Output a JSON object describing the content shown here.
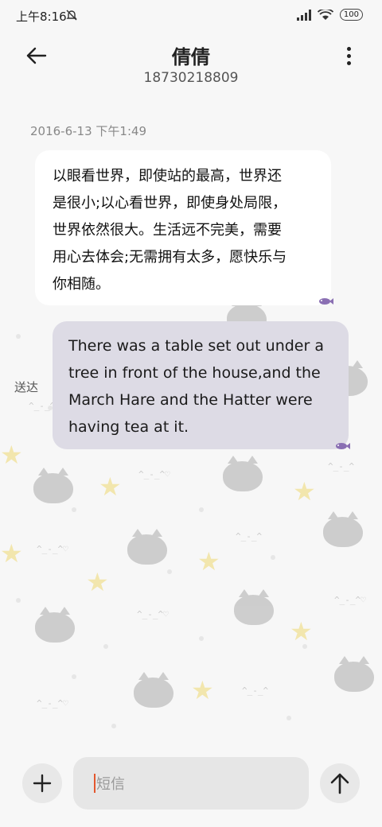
{
  "status_bar": {
    "time": "上午8:16",
    "battery": "100",
    "icons": [
      "do-not-disturb-icon",
      "signal-icon",
      "wifi-icon",
      "battery-icon"
    ]
  },
  "header": {
    "contact_name": "倩倩",
    "contact_number": "18730218809",
    "back_icon": "arrow-left-icon",
    "more_icon": "more-vertical-icon"
  },
  "conversation": {
    "timestamp": "2016-6-13 下午1:49",
    "incoming_lines": [
      "以眼看世界，即使站的最高，世界还",
      "是很小;以心看世界，即使身处局限，",
      "世界依然很大。生活远不完美，需要",
      "用心去体会;无需拥有太多，愿快乐与",
      "你相随。"
    ],
    "outgoing_lines": [
      "There was a table set out under a",
      "tree in front of the house,and the",
      "March Hare and the Hatter were",
      "having tea at it."
    ],
    "delivery_status": "送达"
  },
  "composer": {
    "placeholder": "短信",
    "add_icon": "plus-icon",
    "send_icon": "arrow-up-icon"
  },
  "colors": {
    "background": "#f7f7f7",
    "incoming_bubble": "#ffffff",
    "outgoing_bubble": "#dddbe5",
    "caret": "#e4572e",
    "bubble_tail_accent": "#8a6fb3"
  }
}
